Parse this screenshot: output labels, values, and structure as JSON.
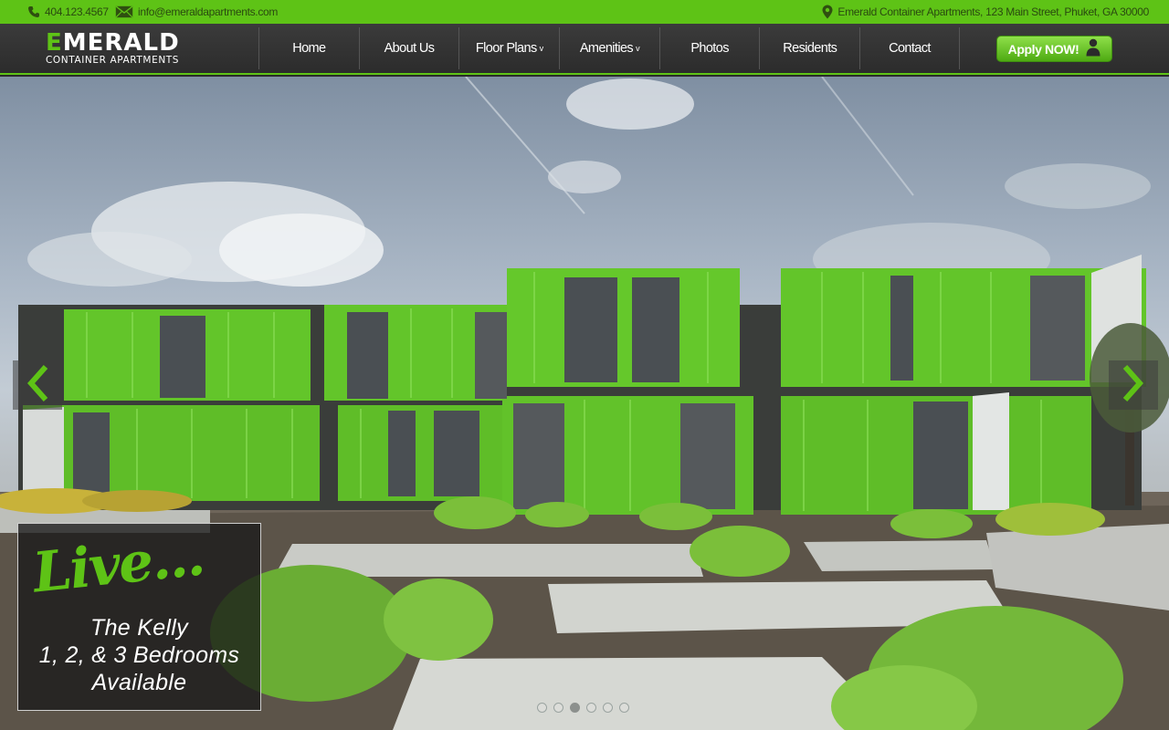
{
  "topbar": {
    "phone": "404.123.4567",
    "email": "info@emeraldapartments.com",
    "address": "Emerald Container Apartments, 123 Main Street, Phuket, GA 30000"
  },
  "logo": {
    "name_e": "E",
    "name_rest": "MERALD",
    "tagline": "CONTAINER APARTMENTS"
  },
  "nav": {
    "items": [
      "Home",
      "About Us",
      "Floor Plans",
      "Amenities",
      "Photos",
      "Residents",
      "Contact"
    ],
    "dropdown_indicator": "v",
    "apply_label": "Apply NOW!"
  },
  "hero": {
    "script_text": "Live...",
    "line1": "The Kelly",
    "line2": "1, 2, & 3 Bedrooms",
    "line3": "Available",
    "slide_count": 6,
    "active_slide": 3
  },
  "colors": {
    "accent": "#5ec316",
    "header_bg": "#333333",
    "container_green": "#63c52a"
  },
  "icons": [
    "phone-icon",
    "envelope-icon",
    "map-pin-icon",
    "person-icon",
    "chevron-left-icon",
    "chevron-right-icon",
    "chevron-down-icon"
  ]
}
